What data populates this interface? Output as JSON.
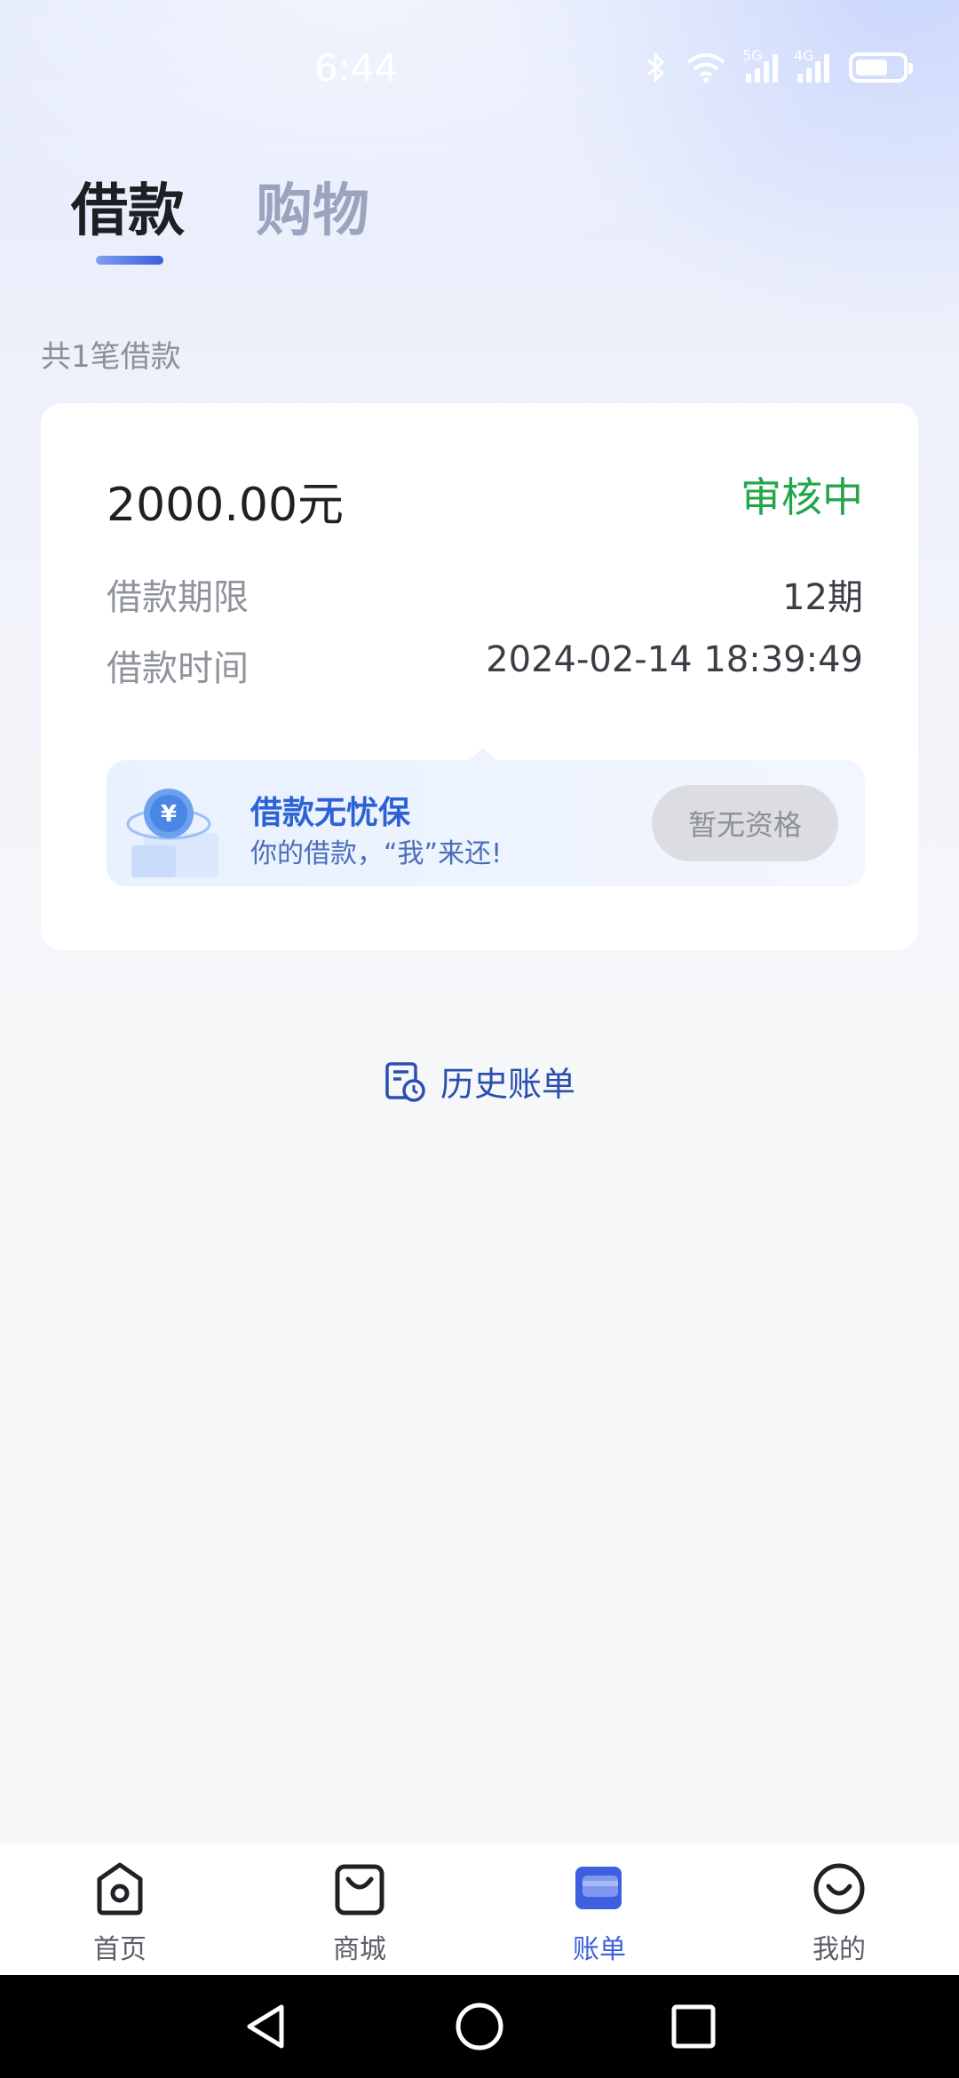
{
  "status_bar": {
    "time": "6:44",
    "signal_5g": "5G",
    "signal_4g": "4G",
    "icons": [
      "bluetooth-icon",
      "wifi-icon",
      "signal-5g-icon",
      "signal-4g-icon",
      "battery-icon"
    ]
  },
  "tabs": [
    {
      "label": "借款",
      "active": true
    },
    {
      "label": "购物",
      "active": false
    }
  ],
  "loan_count_text": "共1笔借款",
  "loan_card": {
    "amount": "2000.00元",
    "status": "审核中",
    "status_color": "#23a64a",
    "term_label": "借款期限",
    "term_value": "12期",
    "time_label": "借款时间",
    "time_value": "2024-02-14 18:39:49",
    "promo": {
      "title": "借款无忧保",
      "subtitle": "你的借款，“我”来还!",
      "button": "暂无资格",
      "icon": "yen-coin-icon"
    }
  },
  "history_bill": {
    "label": "历史账单",
    "icon": "bill-history-icon"
  },
  "bottom_nav": [
    {
      "label": "首页",
      "icon": "home-camera-icon",
      "active": false
    },
    {
      "label": "商城",
      "icon": "shopping-bag-icon",
      "active": false
    },
    {
      "label": "账单",
      "icon": "bill-icon",
      "active": true
    },
    {
      "label": "我的",
      "icon": "smile-face-icon",
      "active": false
    }
  ],
  "system_nav": [
    "back-icon",
    "home-icon",
    "recents-icon"
  ],
  "colors": {
    "accent": "#3d5fe0",
    "text_dark": "#1f2126",
    "text_gray": "#8f939c"
  }
}
